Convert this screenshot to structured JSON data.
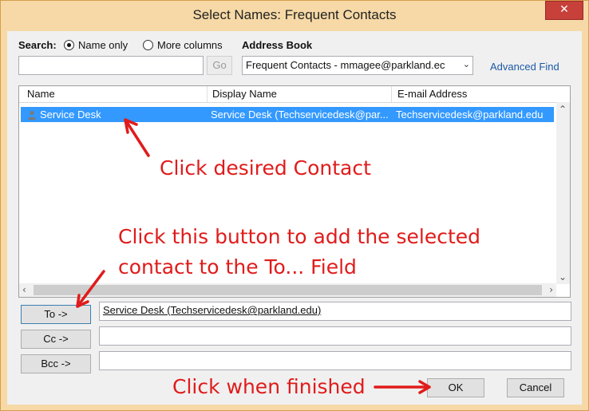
{
  "window": {
    "title": "Select Names: Frequent Contacts",
    "close_glyph": "✕"
  },
  "search": {
    "label": "Search:",
    "options": [
      "Name only",
      "More columns"
    ],
    "selected": "Name only",
    "value": "",
    "go_label": "Go"
  },
  "address_book": {
    "label": "Address Book",
    "selected": "Frequent Contacts - mmagee@parkland.ec",
    "advanced_find": "Advanced Find"
  },
  "list": {
    "columns": [
      "Name",
      "Display Name",
      "E-mail Address"
    ],
    "rows": [
      {
        "name": "Service Desk",
        "display_name": "Service Desk (Techservicedesk@par...",
        "email": "Techservicedesk@parkland.edu",
        "selected": true
      }
    ]
  },
  "recipients": {
    "to_label": "To ->",
    "to_value": "Service Desk (Techservicedesk@parkland.edu)",
    "cc_label": "Cc ->",
    "cc_value": "",
    "bcc_label": "Bcc ->",
    "bcc_value": ""
  },
  "buttons": {
    "ok": "OK",
    "cancel": "Cancel"
  },
  "annotations": {
    "contact": "Click desired Contact",
    "add_line1": "Click this button to add the selected",
    "add_line2": "contact to the To... Field",
    "finish": "Click when finished"
  },
  "colors": {
    "selection": "#3399ff",
    "annotation": "#e01b1b",
    "frame": "#f6d9a6",
    "close": "#c7403a"
  }
}
